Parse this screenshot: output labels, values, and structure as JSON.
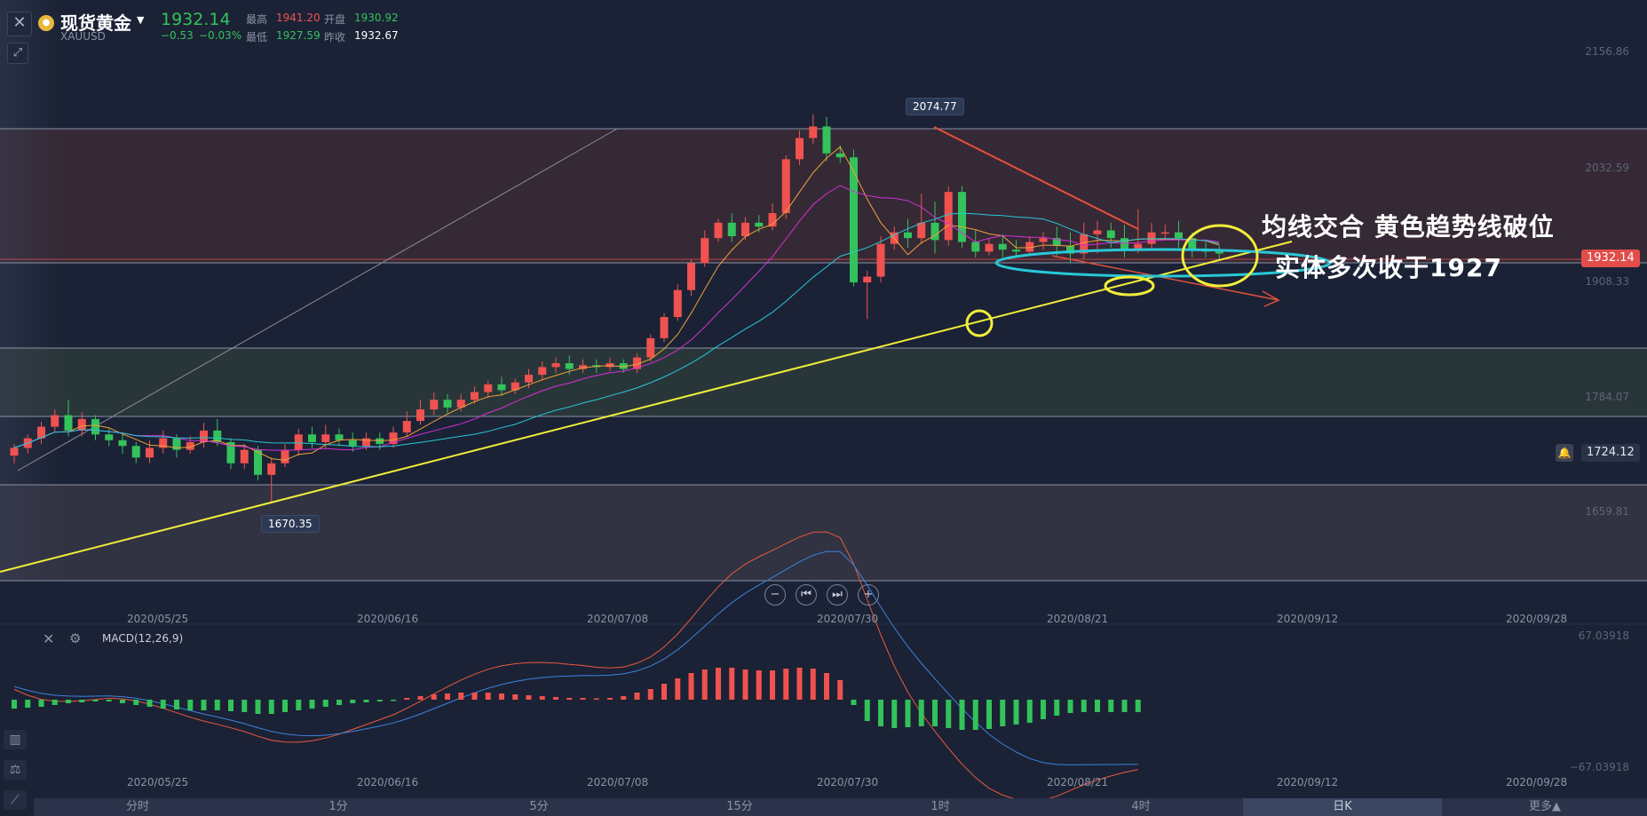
{
  "header": {
    "title": "现货黄金",
    "symbol": "XAUUSD",
    "price": "1932.14",
    "change": "−0.53",
    "change_pct": "−0.03%",
    "high_label": "最高",
    "high_value": "1941.20",
    "open_label": "开盘",
    "open_value": "1930.92",
    "low_label": "最低",
    "low_value": "1927.59",
    "prev_label": "昨收",
    "prev_value": "1932.67"
  },
  "icons": {
    "close": "close-icon",
    "tool": "draw-tool-icon",
    "coin": "gold-coin-icon",
    "bell": "bell-icon"
  },
  "colors": {
    "up": "#f0524f",
    "down": "#33c25b",
    "bg": "#1b2235",
    "ma5": "#f0a13a",
    "ma10": "#d630d6",
    "ma20": "#28c8d8",
    "trend": "#f2ee3a"
  },
  "price_axis": {
    "labels": [
      "2156.86",
      "2032.59",
      "1908.33",
      "1784.07",
      "1659.81"
    ],
    "current_badge": "1932.14",
    "alert_value": "1724.12"
  },
  "tooltips": {
    "high": "2074.77",
    "low": "1670.35"
  },
  "annotations": {
    "line1": "均线交合 黄色趋势线破位",
    "line2": "实体多次收于1927"
  },
  "dates": [
    "2020/05/25",
    "2020/06/16",
    "2020/07/08",
    "2020/07/30",
    "2020/08/21",
    "2020/09/12",
    "2020/09/28"
  ],
  "macd": {
    "label": "MACD(12,26,9)",
    "top": "67.03918",
    "bottom": "−67.03918"
  },
  "tabs": [
    "分时",
    "1分",
    "5分",
    "15分",
    "1时",
    "4时",
    "日K",
    "更多▲"
  ],
  "chart_data": {
    "type": "candlestick",
    "symbol": "XAUUSD",
    "interval": "日K",
    "x": [
      "2020/05/25",
      "2020/06/16",
      "2020/07/08",
      "2020/07/30",
      "2020/08/21",
      "2020/09/12",
      "2020/09/28"
    ],
    "ylim": [
      1590,
      2175
    ],
    "high_marker": 2074.77,
    "low_marker": 1670.35,
    "last_price": 1932.14,
    "candles": [
      [
        1720,
        1728,
        1712,
        1732
      ],
      [
        1728,
        1738,
        1722,
        1742
      ],
      [
        1738,
        1750,
        1732,
        1755
      ],
      [
        1750,
        1762,
        1744,
        1768
      ],
      [
        1762,
        1746,
        1740,
        1778
      ],
      [
        1746,
        1758,
        1740,
        1765
      ],
      [
        1758,
        1742,
        1736,
        1762
      ],
      [
        1742,
        1736,
        1730,
        1748
      ],
      [
        1736,
        1730,
        1722,
        1742
      ],
      [
        1730,
        1718,
        1712,
        1734
      ],
      [
        1718,
        1728,
        1712,
        1736
      ],
      [
        1728,
        1738,
        1722,
        1746
      ],
      [
        1738,
        1726,
        1718,
        1742
      ],
      [
        1726,
        1734,
        1722,
        1740
      ],
      [
        1734,
        1746,
        1728,
        1754
      ],
      [
        1746,
        1734,
        1730,
        1758
      ],
      [
        1734,
        1712,
        1706,
        1738
      ],
      [
        1712,
        1726,
        1706,
        1732
      ],
      [
        1726,
        1700,
        1694,
        1730
      ],
      [
        1700,
        1712,
        1670,
        1718
      ],
      [
        1712,
        1726,
        1708,
        1732
      ],
      [
        1726,
        1742,
        1720,
        1748
      ],
      [
        1742,
        1734,
        1728,
        1750
      ],
      [
        1734,
        1742,
        1728,
        1752
      ],
      [
        1742,
        1736,
        1730,
        1748
      ],
      [
        1736,
        1730,
        1724,
        1744
      ],
      [
        1730,
        1738,
        1726,
        1744
      ],
      [
        1738,
        1732,
        1726,
        1744
      ],
      [
        1732,
        1744,
        1728,
        1750
      ],
      [
        1744,
        1756,
        1740,
        1766
      ],
      [
        1756,
        1768,
        1752,
        1778
      ],
      [
        1768,
        1778,
        1762,
        1786
      ],
      [
        1778,
        1770,
        1764,
        1784
      ],
      [
        1770,
        1778,
        1766,
        1784
      ],
      [
        1778,
        1786,
        1774,
        1792
      ],
      [
        1786,
        1794,
        1780,
        1798
      ],
      [
        1794,
        1788,
        1782,
        1802
      ],
      [
        1788,
        1796,
        1784,
        1800
      ],
      [
        1796,
        1804,
        1790,
        1810
      ],
      [
        1804,
        1812,
        1798,
        1818
      ],
      [
        1812,
        1816,
        1806,
        1822
      ],
      [
        1816,
        1810,
        1804,
        1824
      ],
      [
        1810,
        1814,
        1806,
        1820
      ],
      [
        1814,
        1812,
        1806,
        1820
      ],
      [
        1812,
        1816,
        1808,
        1822
      ],
      [
        1816,
        1810,
        1806,
        1820
      ],
      [
        1810,
        1822,
        1806,
        1826
      ],
      [
        1822,
        1842,
        1818,
        1846
      ],
      [
        1842,
        1864,
        1838,
        1868
      ],
      [
        1864,
        1892,
        1860,
        1898
      ],
      [
        1892,
        1920,
        1886,
        1924
      ],
      [
        1920,
        1946,
        1916,
        1954
      ],
      [
        1946,
        1962,
        1942,
        1966
      ],
      [
        1962,
        1948,
        1942,
        1972
      ],
      [
        1948,
        1962,
        1944,
        1968
      ],
      [
        1962,
        1958,
        1952,
        1970
      ],
      [
        1958,
        1972,
        1954,
        1982
      ],
      [
        1972,
        2028,
        1966,
        2032
      ],
      [
        2028,
        2050,
        2022,
        2058
      ],
      [
        2050,
        2062,
        2044,
        2074.77
      ],
      [
        2062,
        2034,
        2026,
        2072
      ],
      [
        2034,
        2030,
        2024,
        2042
      ],
      [
        2030,
        1900,
        1896,
        2038
      ],
      [
        1900,
        1906,
        1862,
        1912
      ],
      [
        1906,
        1940,
        1900,
        1948
      ],
      [
        1940,
        1952,
        1934,
        1958
      ],
      [
        1952,
        1946,
        1936,
        1966
      ],
      [
        1946,
        1962,
        1940,
        1992
      ],
      [
        1962,
        1944,
        1930,
        1984
      ],
      [
        1944,
        1994,
        1938,
        2000
      ],
      [
        1994,
        1942,
        1936,
        2000
      ],
      [
        1942,
        1932,
        1926,
        1954
      ],
      [
        1932,
        1940,
        1928,
        1946
      ],
      [
        1940,
        1934,
        1926,
        1950
      ],
      [
        1934,
        1932,
        1926,
        1944
      ],
      [
        1932,
        1942,
        1928,
        1948
      ],
      [
        1942,
        1946,
        1934,
        1952
      ],
      [
        1946,
        1938,
        1928,
        1958
      ],
      [
        1938,
        1930,
        1920,
        1952
      ],
      [
        1930,
        1950,
        1924,
        1962
      ],
      [
        1950,
        1954,
        1930,
        1964
      ],
      [
        1954,
        1946,
        1936,
        1962
      ],
      [
        1946,
        1934,
        1926,
        1960
      ],
      [
        1934,
        1940,
        1930,
        1976
      ],
      [
        1940,
        1952,
        1934,
        1962
      ],
      [
        1952,
        1952,
        1944,
        1960
      ],
      [
        1952,
        1946,
        1936,
        1964
      ],
      [
        1946,
        1934,
        1926,
        1952
      ],
      [
        1934,
        1932,
        1926,
        1942
      ],
      [
        1932,
        1930,
        1924,
        1938
      ]
    ],
    "macd_hist": [
      -10,
      -9,
      -8,
      -6,
      -4,
      -3,
      -2,
      -2,
      -4,
      -6,
      -8,
      -10,
      -11,
      -12,
      -12,
      -12,
      -13,
      -14,
      -16,
      -16,
      -14,
      -12,
      -10,
      -8,
      -6,
      -4,
      -3,
      -2,
      -1,
      2,
      4,
      6,
      7,
      8,
      8,
      8,
      7,
      6,
      5,
      4,
      3,
      2,
      2,
      1,
      2,
      4,
      8,
      12,
      18,
      24,
      30,
      34,
      36,
      36,
      34,
      33,
      33,
      35,
      36,
      35,
      30,
      22,
      -6,
      -24,
      -30,
      -32,
      -31,
      -30,
      -30,
      -32,
      -34,
      -34,
      -33,
      -30,
      -28,
      -26,
      -22,
      -18,
      -15,
      -14,
      -14,
      -14,
      -14,
      -14
    ]
  }
}
